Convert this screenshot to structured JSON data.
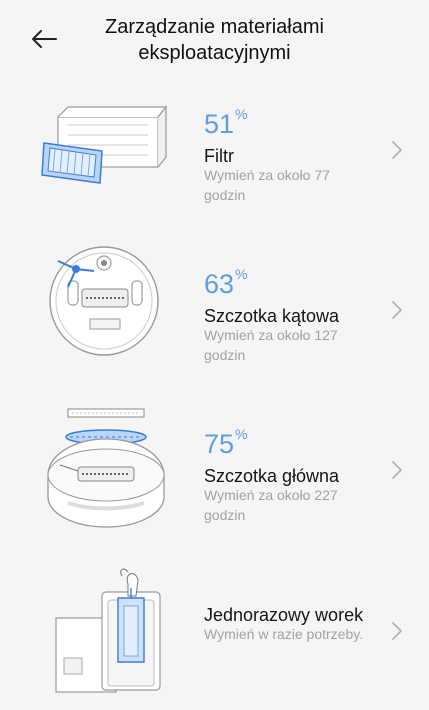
{
  "header": {
    "title_line1": "Zarządzanie materiałami",
    "title_line2": "eksploatacyjnymi"
  },
  "colors": {
    "accent": "#5d9de8",
    "text": "#151515",
    "muted": "#a2a2a2",
    "background": "#f5f5f5"
  },
  "items": [
    {
      "percent": "51",
      "percent_unit": "%",
      "name": "Filtr",
      "hint": "Wymień za około 77 godzin",
      "icon": "filter-icon"
    },
    {
      "percent": "63",
      "percent_unit": "%",
      "name": "Szczotka kątowa",
      "hint": "Wymień za około 127 godzin",
      "icon": "side-brush-icon"
    },
    {
      "percent": "75",
      "percent_unit": "%",
      "name": "Szczotka główna",
      "hint": "Wymień za około 227 godzin",
      "icon": "main-brush-icon"
    },
    {
      "name": "Jednorazowy worek",
      "hint": "Wymień w razie potrzeby.",
      "icon": "dust-bag-icon"
    }
  ]
}
